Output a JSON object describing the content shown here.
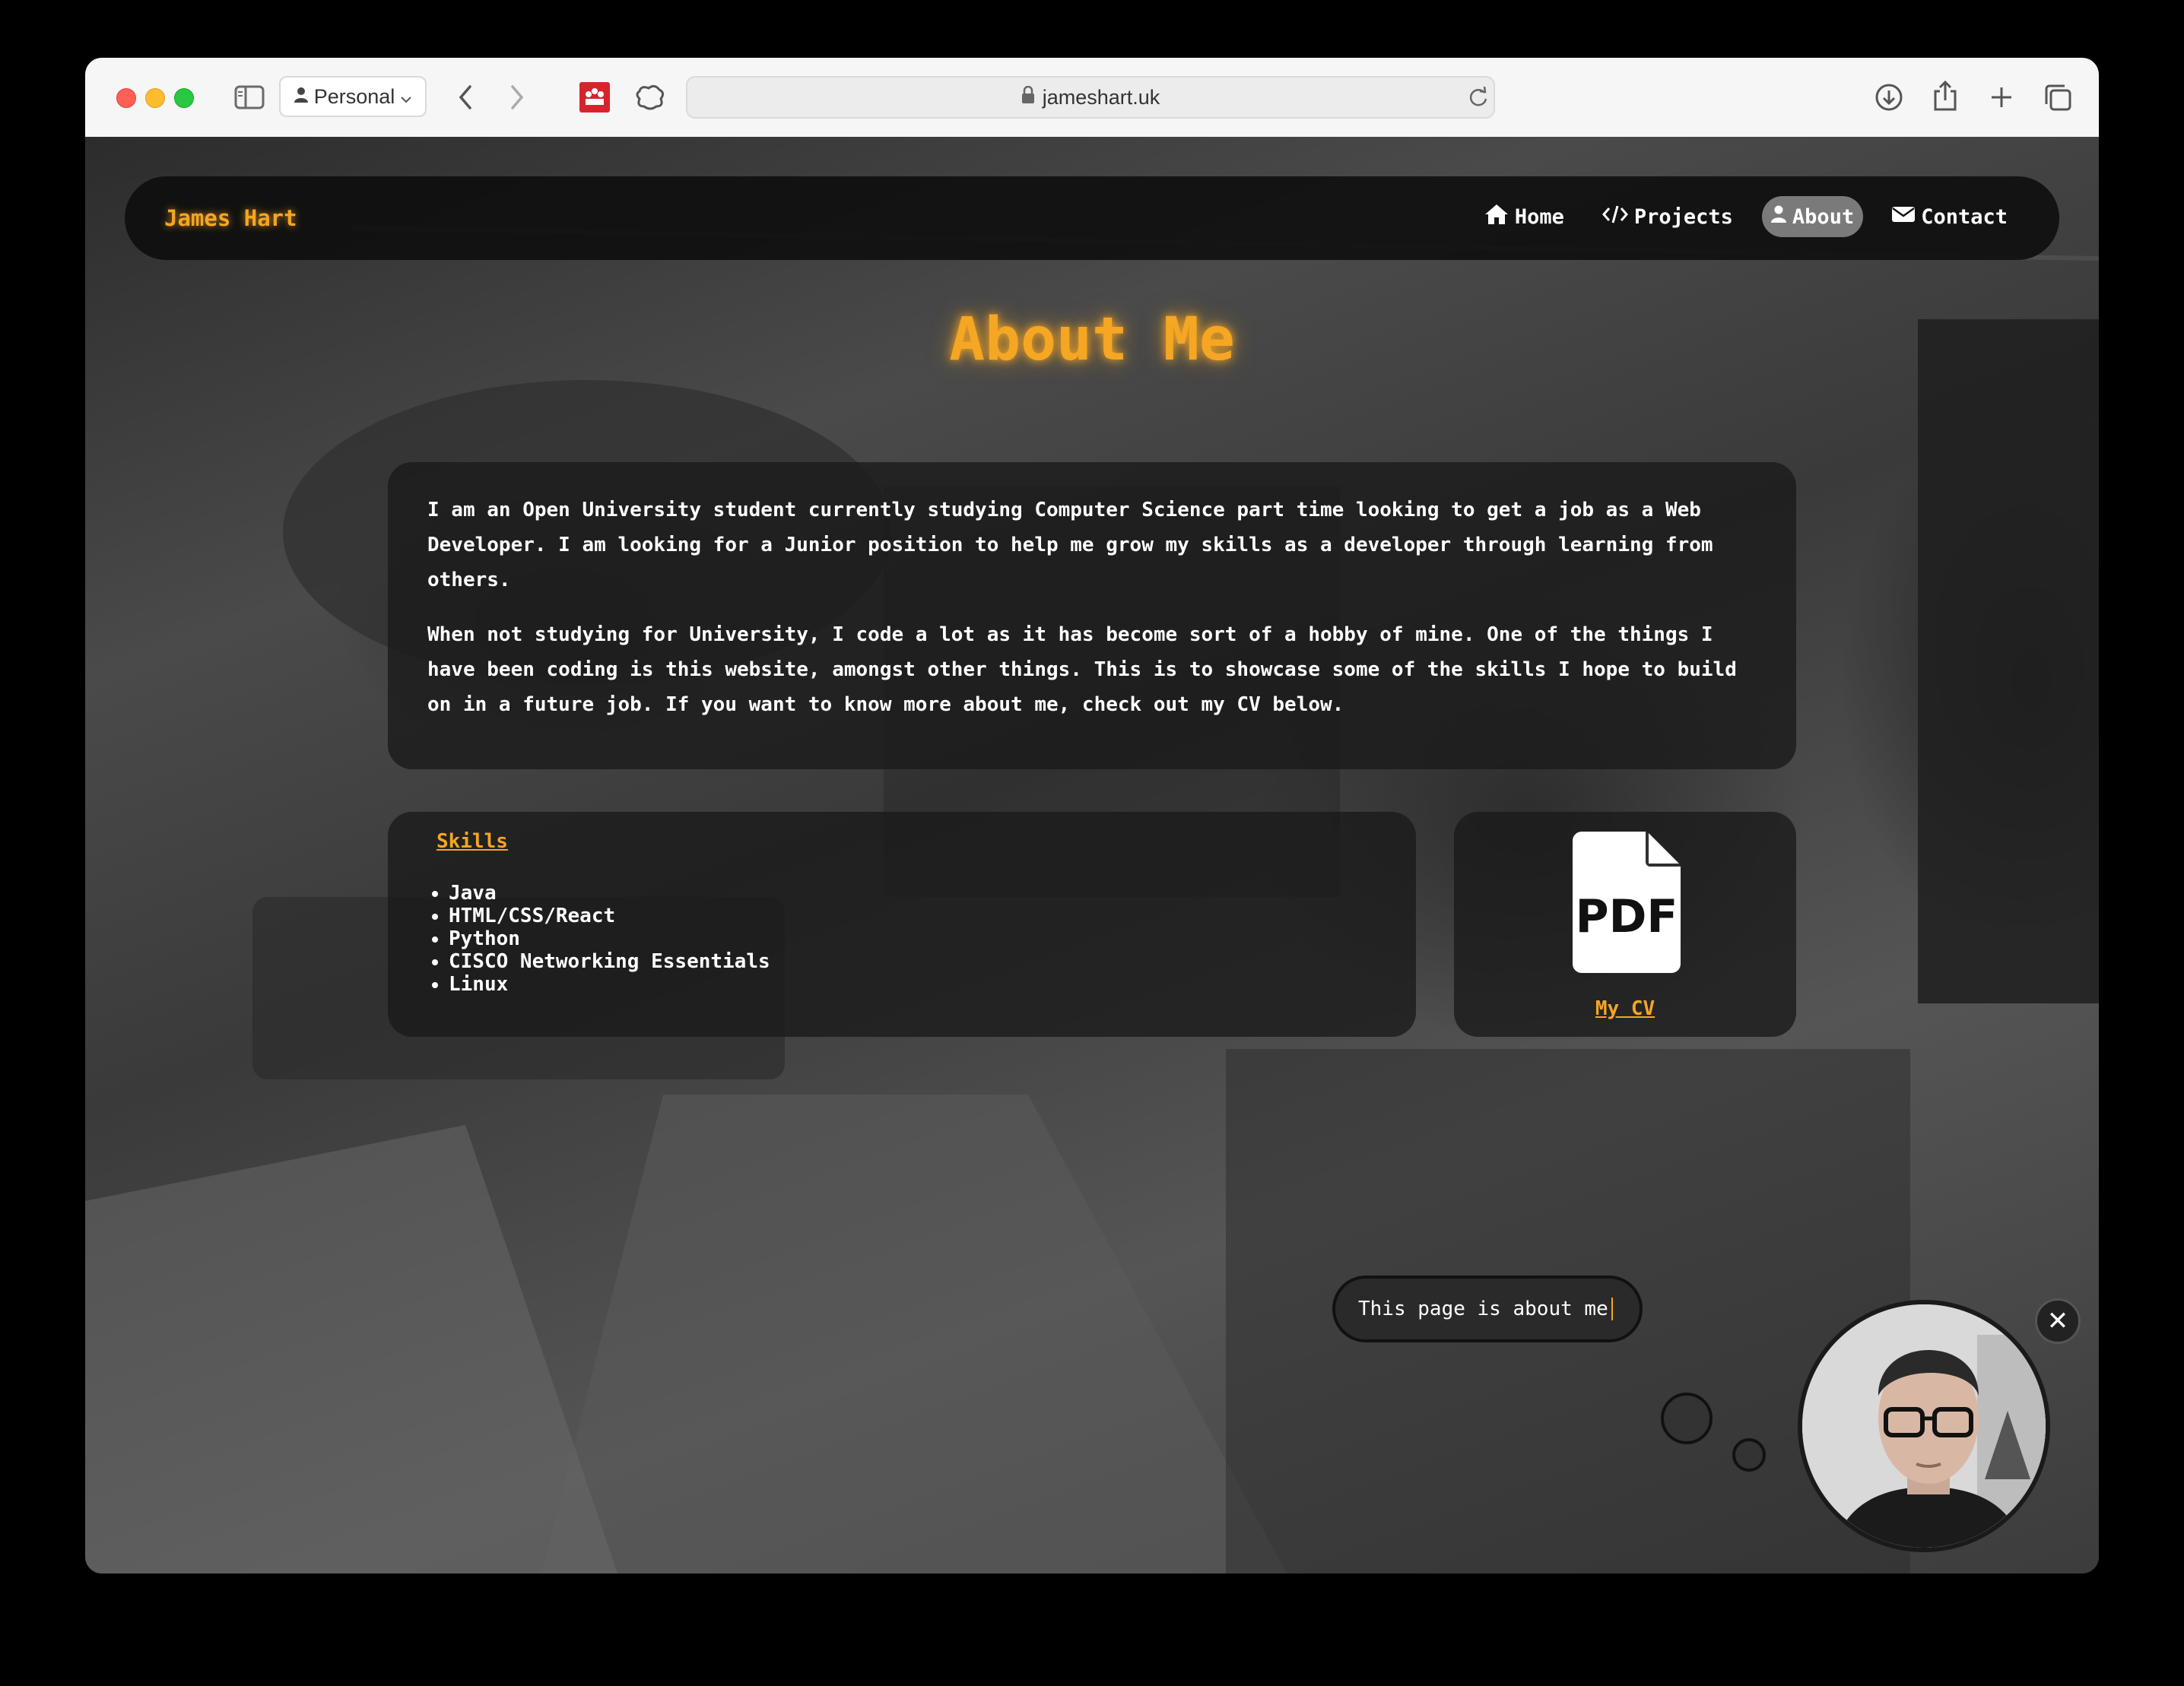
{
  "browser": {
    "profile": "Personal",
    "url": "jameshart.uk"
  },
  "site": {
    "brand": "James Hart",
    "nav": [
      {
        "label": "Home",
        "icon": "home-icon",
        "active": false
      },
      {
        "label": "Projects",
        "icon": "code-icon",
        "active": false
      },
      {
        "label": "About",
        "icon": "user-icon",
        "active": true
      },
      {
        "label": "Contact",
        "icon": "envelope-icon",
        "active": false
      }
    ]
  },
  "about": {
    "heading": "About Me",
    "paragraphs": [
      "I am an Open University student currently studying Computer Science part time looking to get a job as a Web Developer. I am looking for a Junior position to help me grow my skills as a developer through learning from others.",
      "When not studying for University, I code a lot as it has become sort of a hobby of mine. One of the things I have been coding is this website, amongst other things. This is to showcase some of the skills I hope to build on in a future job. If you want to know more about me, check out my CV below."
    ],
    "skills_title": "Skills",
    "skills": [
      "Java",
      "HTML/CSS/React",
      "Python",
      "CISCO Networking Essentials",
      "Linux"
    ],
    "pdf_icon_label": "PDF",
    "cv_link": "My CV"
  },
  "chat": {
    "bubble_text": "This page is about me",
    "close": "✕"
  },
  "colors": {
    "accent": "#f5a623",
    "navbar": "#0c0c0c",
    "panel": "#191919"
  }
}
